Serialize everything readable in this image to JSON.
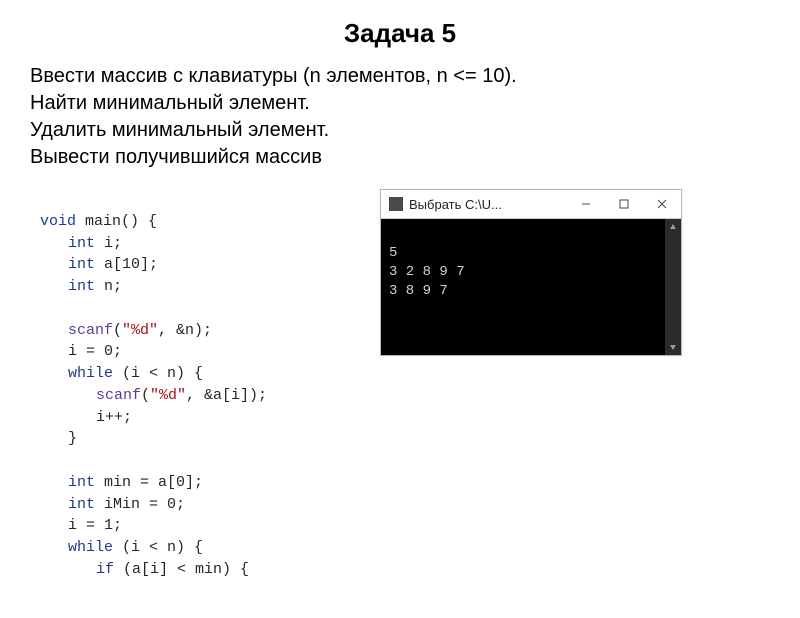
{
  "title": "Задача 5",
  "task": {
    "l1": "Ввести массив с клавиатуры (n элементов, n <= 10).",
    "l2": "Найти минимальный элемент.",
    "l3": "Удалить минимальный элемент.",
    "l4": "Вывести получившийся массив"
  },
  "code": {
    "l01a": "void",
    "l01b": " main() {",
    "l02a": "int",
    "l02b": " i;",
    "l03a": "int",
    "l03b": " a[10];",
    "l04a": "int",
    "l04b": " n;",
    "l05": "",
    "l06a": "scanf",
    "l06b": "(",
    "l06c": "\"%d\"",
    "l06d": ", &n);",
    "l07": "i = 0;",
    "l08a": "while",
    "l08b": " (i < n) {",
    "l09a": "scanf",
    "l09b": "(",
    "l09c": "\"%d\"",
    "l09d": ", &a[i]);",
    "l10": "i++;",
    "l11": "}",
    "l12": "",
    "l13a": "int",
    "l13b": " min = a[0];",
    "l14a": "int",
    "l14b": " iMin = 0;",
    "l15": "i = 1;",
    "l16a": "while",
    "l16b": " (i < n) {",
    "l17a": "if",
    "l17b": " (a[i] < min) {"
  },
  "console": {
    "window_title": "Выбрать C:\\U...",
    "icon_name": "console-app-icon",
    "buttons": {
      "min": "—",
      "max": "□",
      "close": "×"
    },
    "output": {
      "l1": "5",
      "l2": "3 2 8 9 7",
      "l3": "3 8 9 7"
    }
  }
}
